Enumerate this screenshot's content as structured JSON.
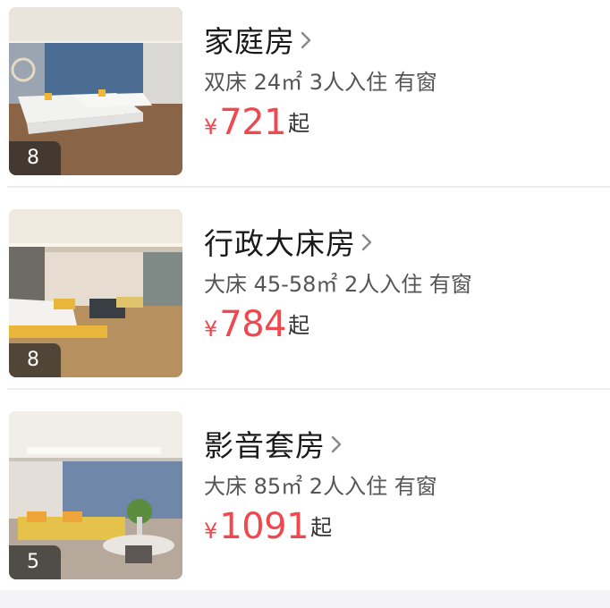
{
  "rooms": [
    {
      "name": "家庭房",
      "attrs": "双床 24㎡ 3人入住 有窗",
      "currency": "¥",
      "price": "721",
      "suffix": "起",
      "photo_count": "8"
    },
    {
      "name": "行政大床房",
      "attrs": "大床 45-58㎡ 2人入住 有窗",
      "currency": "¥",
      "price": "784",
      "suffix": "起",
      "photo_count": "8"
    },
    {
      "name": "影音套房",
      "attrs": "大床 85㎡ 2人入住 有窗",
      "currency": "¥",
      "price": "1091",
      "suffix": "起",
      "photo_count": "5"
    }
  ],
  "colors": {
    "price": "#f0484f",
    "title": "#1a1a1a",
    "meta": "#555555",
    "divider": "#eeeef1"
  },
  "icons": {
    "chevron": "chevron-right-icon"
  }
}
